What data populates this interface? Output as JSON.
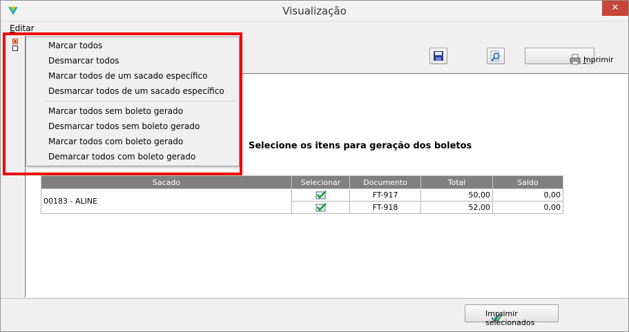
{
  "window": {
    "title": "Visualização",
    "close_glyph": "✕"
  },
  "menu": {
    "editar_first": "E",
    "editar_rest": "ditar"
  },
  "context_menu": {
    "items": [
      "Marcar todos",
      "Desmarcar todos",
      "Marcar todos de um sacado específico",
      "Desmarcar todos de um sacado específico",
      "Marcar todos sem boleto gerado",
      "Desmarcar todos sem boleto gerado",
      "Marcar todos com boleto gerado",
      "Demarcar todos com boleto gerado"
    ]
  },
  "toolbar": {
    "print_first": "I",
    "print_rest": "mprimir"
  },
  "content": {
    "heading": "Selecione os itens para geração dos boletos"
  },
  "table": {
    "headers": [
      "Sacado",
      "Selecionar",
      "Documento",
      "Total",
      "Saldo"
    ],
    "sacado": "00183 - ALINE",
    "rows": [
      {
        "documento": "FT-917",
        "total": "50,00",
        "saldo": "0,00",
        "selected": true
      },
      {
        "documento": "FT-918",
        "total": "52,00",
        "saldo": "0,00",
        "selected": true
      }
    ]
  },
  "footer": {
    "print_selected_label": "Imprimir selecionados"
  },
  "colors": {
    "highlight_border": "#ee0000",
    "header_bg": "#808080",
    "close_bg": "#c7463a"
  },
  "icons": [
    "app-logo-icon",
    "save-disk-icon",
    "zoom-preview-icon",
    "printer-icon",
    "checkmark-icon"
  ]
}
